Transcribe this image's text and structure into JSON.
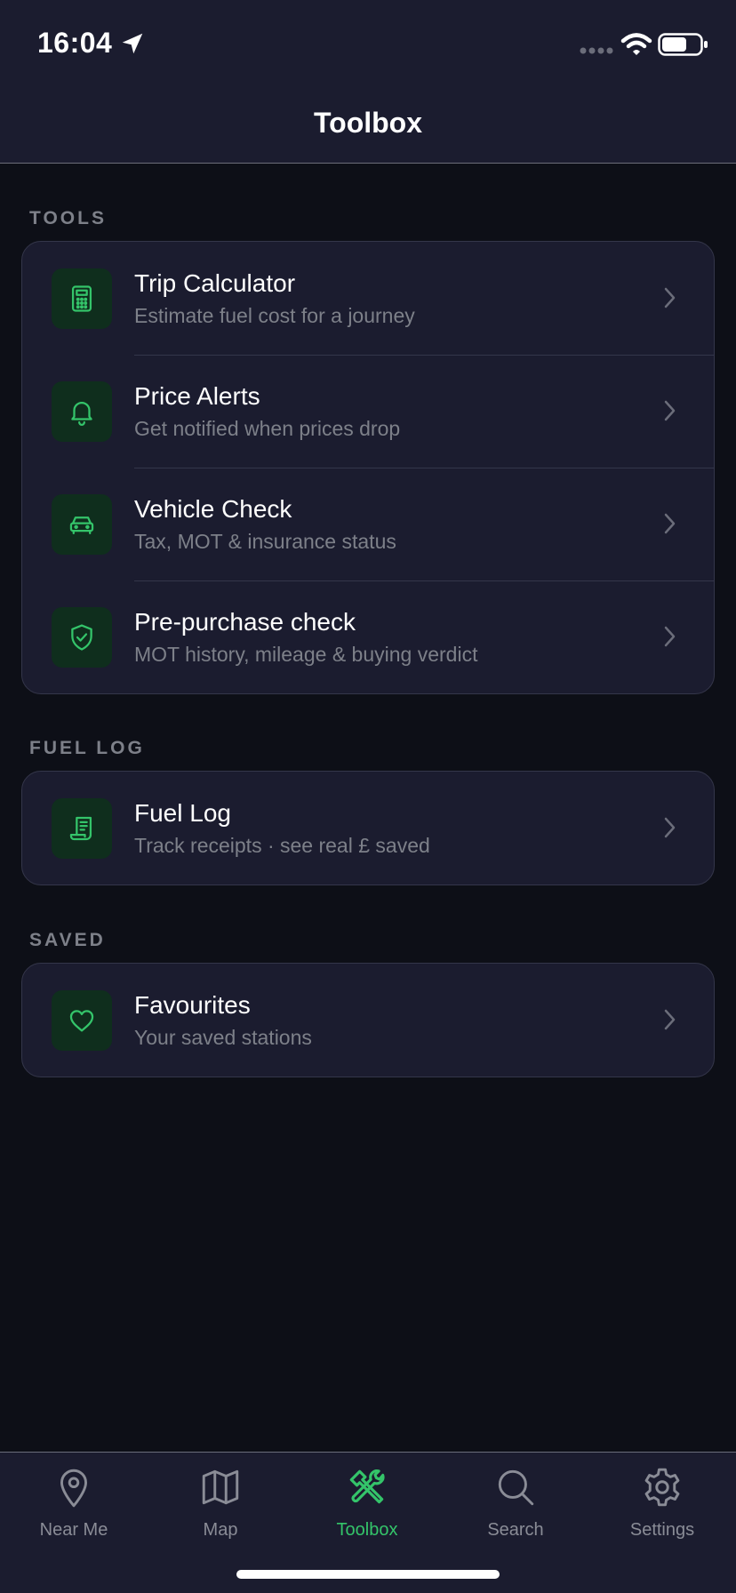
{
  "status_bar": {
    "time": "16:04",
    "icons": [
      "location-arrow-icon",
      "signal-dots-icon",
      "wifi-icon",
      "battery-icon"
    ]
  },
  "header": {
    "title": "Toolbox"
  },
  "colors": {
    "accent": "#34c46a",
    "background": "#0d0f17",
    "card": "#1b1c2f",
    "icon_tile": "#0f2e1d",
    "secondary_text": "#7d8089"
  },
  "sections": [
    {
      "title": "TOOLS",
      "items": [
        {
          "title": "Trip Calculator",
          "subtitle": "Estimate fuel cost for a journey",
          "icon": "calculator-icon"
        },
        {
          "title": "Price Alerts",
          "subtitle": "Get notified when prices drop",
          "icon": "bell-icon"
        },
        {
          "title": "Vehicle Check",
          "subtitle": "Tax, MOT & insurance status",
          "icon": "car-icon"
        },
        {
          "title": "Pre-purchase check",
          "subtitle": "MOT history, mileage & buying verdict",
          "icon": "shield-check-icon"
        }
      ]
    },
    {
      "title": "FUEL LOG",
      "items": [
        {
          "title": "Fuel Log",
          "subtitle": "Track receipts · see real £ saved",
          "icon": "receipt-icon"
        }
      ]
    },
    {
      "title": "SAVED",
      "items": [
        {
          "title": "Favourites",
          "subtitle": "Your saved stations",
          "icon": "heart-icon"
        }
      ]
    }
  ],
  "tabbar": {
    "active": "Toolbox",
    "tabs": [
      {
        "label": "Near Me",
        "icon": "map-pin-icon"
      },
      {
        "label": "Map",
        "icon": "map-icon"
      },
      {
        "label": "Toolbox",
        "icon": "tools-icon"
      },
      {
        "label": "Search",
        "icon": "search-icon"
      },
      {
        "label": "Settings",
        "icon": "gear-icon"
      }
    ]
  }
}
